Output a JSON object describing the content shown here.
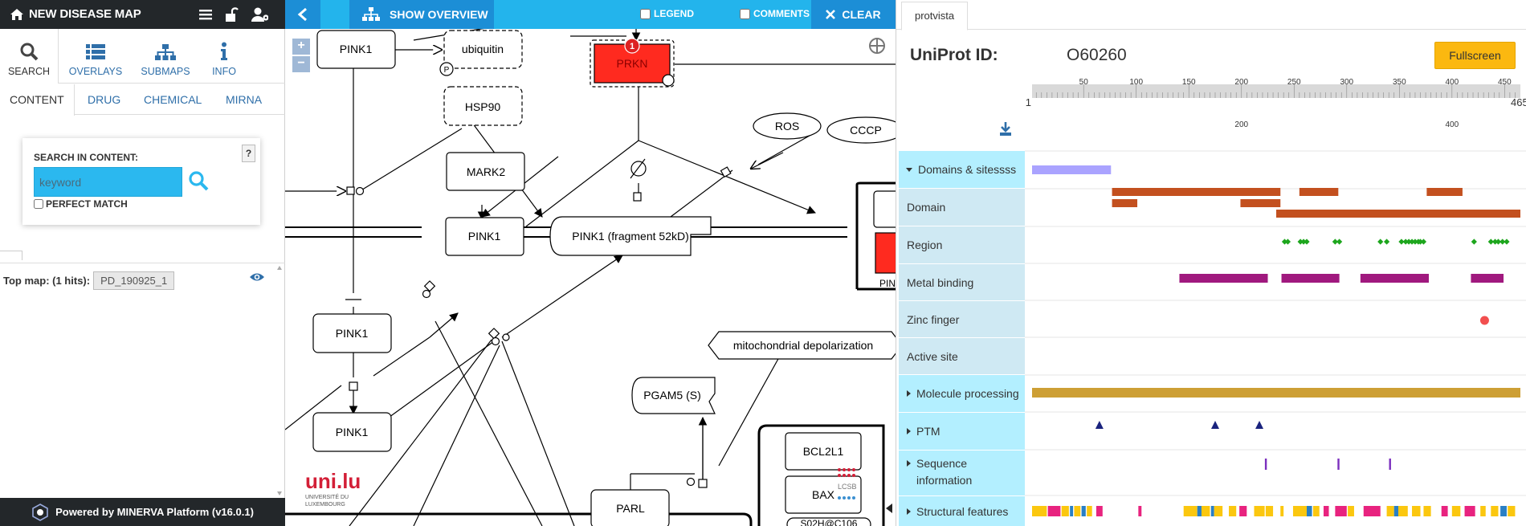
{
  "app": {
    "title": "NEW DISEASE MAP",
    "footer": "Powered by MINERVA Platform (v16.0.1)"
  },
  "nav_tabs": [
    {
      "label": "SEARCH",
      "icon": "search-icon"
    },
    {
      "label": "OVERLAYS",
      "icon": "list-icon"
    },
    {
      "label": "SUBMAPS",
      "icon": "sitemap-icon"
    },
    {
      "label": "INFO",
      "icon": "info-icon"
    }
  ],
  "sub_tabs": [
    "CONTENT",
    "DRUG",
    "CHEMICAL",
    "MIRNA"
  ],
  "search": {
    "label": "SEARCH IN CONTENT:",
    "help": "?",
    "placeholder": "keyword",
    "perfect_match": "PERFECT MATCH"
  },
  "results": {
    "label": "Top map: (1 hits):",
    "map_button": "PD_190925_1"
  },
  "map_toolbar": {
    "overview": "SHOW OVERVIEW",
    "legend": "LEGEND",
    "comments": "COMMENTS",
    "clear": "CLEAR"
  },
  "diagram": {
    "nodes": {
      "pink1_a": "PINK1",
      "ubiquitin": "ubiquitin",
      "prkn": "PRKN",
      "hsp90": "HSP90",
      "mark2": "MARK2",
      "pink1_b": "PINK1",
      "pink1_frag": "PINK1 (fragment 52kD)",
      "ros": "ROS",
      "cccp": "CCCP",
      "pink1_c": "PINK1",
      "pink1_d": "PINK1",
      "mito_dep": "mitochondrial depolarization",
      "pgam5": "PGAM5 (S)",
      "bcl2l1": "BCL2L1",
      "bax": "BAX",
      "parl": "PARL",
      "s02h": "S02H@C106",
      "pin_partial": "PIN",
      "p_badge": "P",
      "pin_badge": "1"
    },
    "logos": {
      "uni_lu": "uni.lu",
      "uni_lu_sub1": "UNIVERSITÉ DU",
      "uni_lu_sub2": "LUXEMBOURG",
      "lcsb": "LCSB"
    }
  },
  "protvista": {
    "tab": "protvista",
    "uniprot_label": "UniProt ID:",
    "uniprot_id": "O60260",
    "fullscreen": "Fullscreen",
    "ruler_ticks": [
      "1",
      "50",
      "100",
      "150",
      "200",
      "250",
      "300",
      "350",
      "400",
      "450",
      "465"
    ],
    "ruler_sub_ticks": [
      "200",
      "400"
    ],
    "tracks": [
      {
        "label": "Domains & sitessss",
        "expandable": true,
        "expanded": true
      },
      {
        "label": "Domain"
      },
      {
        "label": "Region"
      },
      {
        "label": "Metal binding"
      },
      {
        "label": "Zinc finger"
      },
      {
        "label": "Active site"
      },
      {
        "label": "Molecule processing",
        "expandable": true
      },
      {
        "label": "PTM",
        "expandable": true
      },
      {
        "label": "Sequence information",
        "expandable": true
      },
      {
        "label": "Structural features",
        "expandable": true
      }
    ],
    "colors": {
      "domain": "#aaa3ff",
      "region": "#c3501f",
      "metal": "#1da61d",
      "zinc": "#a0197e",
      "active": "#f24f4f",
      "processing": "#cd9f35",
      "ptm": "#1a237e",
      "seq": "#7b2fbe"
    }
  }
}
